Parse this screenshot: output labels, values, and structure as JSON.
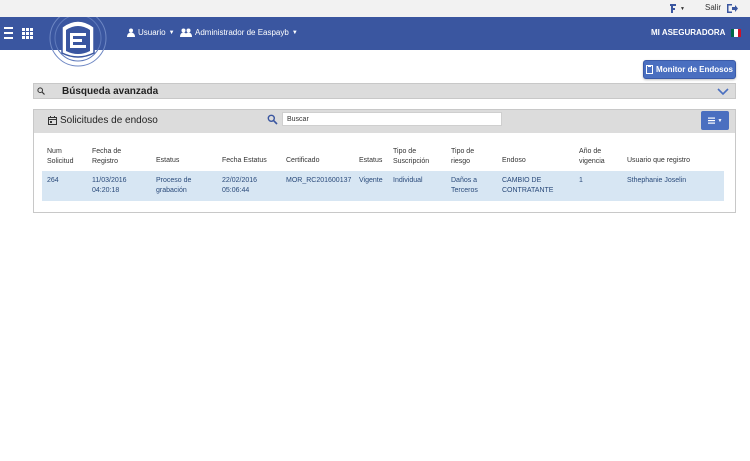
{
  "topbar": {
    "logout_label": "Salir"
  },
  "navbar": {
    "user_label": "Usuario",
    "admin_label": "Administrador de Easpayb",
    "brand": "MI ASEGURADORA",
    "flag_colors": [
      "#006847",
      "#ffffff",
      "#ce1126"
    ]
  },
  "actions": {
    "monitor_label": "Monitor de Endosos"
  },
  "advanced_search": {
    "label": "Búsqueda avanzada"
  },
  "panel": {
    "title": "Solicitudes de endoso",
    "search_placeholder": "Buscar"
  },
  "table": {
    "headers": {
      "num_solicitud": "Num\nSolicitud",
      "fecha_registro": "Fecha de\nRegistro",
      "estatus": "Estatus",
      "fecha_estatus": "Fecha Estatus",
      "certificado": "Certificado",
      "estatus2": "Estatus",
      "tipo_suscripcion": "Tipo de\nSuscripción",
      "tipo_riesgo": "Tipo de\nriesgo",
      "endoso": "Endoso",
      "anio_vigencia": "Año de\nvigencia",
      "usuario": "Usuario que registro"
    },
    "rows": [
      {
        "num_solicitud": "264",
        "fecha_registro": "11/03/2016\n04:20:18",
        "estatus": "Proceso de\ngrabación",
        "fecha_estatus": "22/02/2016\n05:06:44",
        "certificado": "MOR_RC201600137",
        "estatus2": "Vigente",
        "tipo_suscripcion": "Individual",
        "tipo_riesgo": "Daños a\nTerceros",
        "endoso": "CAMBIO DE\nCONTRATANTE",
        "anio_vigencia": "1",
        "usuario": "Sthephanie Joselin"
      }
    ]
  },
  "colors": {
    "navbar": "#3a56a0",
    "button": "#4a6fc0",
    "row_highlight": "#d7e6f3"
  }
}
